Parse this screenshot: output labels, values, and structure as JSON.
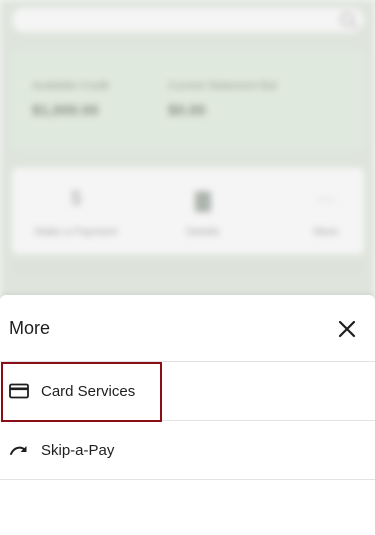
{
  "background": {
    "search": {
      "placeholder": ""
    },
    "balances": [
      {
        "label": "Available Credit",
        "value": "$1,000.00"
      },
      {
        "label": "Current Statement Bal",
        "value": "$0.00"
      }
    ],
    "actions": [
      {
        "icon": "dollar-icon",
        "glyph": "$",
        "label": "Make a Payment"
      },
      {
        "icon": "document-icon",
        "glyph": "▇",
        "label": "Details"
      },
      {
        "icon": "more-icon",
        "glyph": "···",
        "label": "More"
      }
    ]
  },
  "sheet": {
    "title": "More",
    "items": [
      {
        "label": "Card Services",
        "icon": "credit-card-icon"
      },
      {
        "label": "Skip-a-Pay",
        "icon": "redo-arrow-icon"
      }
    ]
  },
  "colors": {
    "highlight": "#8b0e16",
    "background_tint": "#e9efe7"
  }
}
